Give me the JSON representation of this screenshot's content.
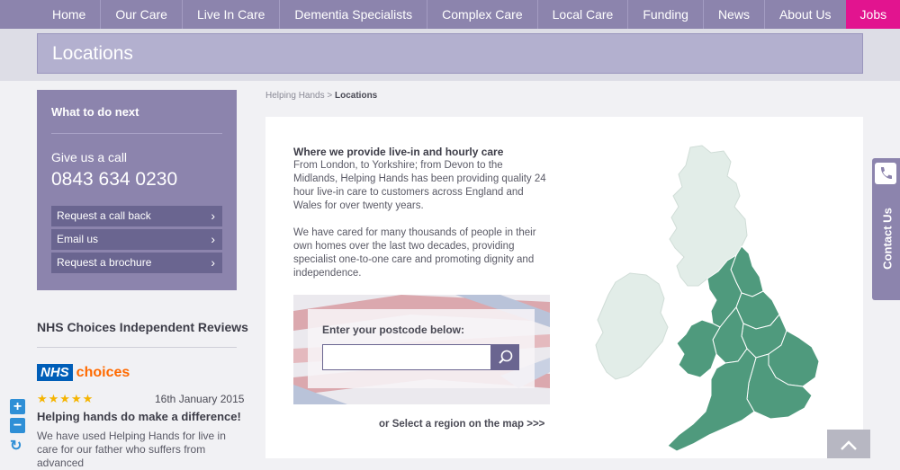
{
  "nav": {
    "items": [
      {
        "label": "Home"
      },
      {
        "label": "Our Care"
      },
      {
        "label": "Live In Care"
      },
      {
        "label": "Dementia Specialists"
      },
      {
        "label": "Complex Care"
      },
      {
        "label": "Local Care"
      },
      {
        "label": "Funding"
      },
      {
        "label": "News"
      },
      {
        "label": "About Us"
      },
      {
        "label": "Jobs"
      }
    ]
  },
  "page_title": "Locations",
  "breadcrumb": {
    "parent": "Helping Hands",
    "separator": " > ",
    "current": "Locations"
  },
  "what_next": {
    "title": "What to do next",
    "call_label": "Give us a call",
    "phone": "0843 634 0230",
    "buttons": [
      {
        "label": "Request a call back"
      },
      {
        "label": "Email us"
      },
      {
        "label": "Request a brochure"
      }
    ]
  },
  "reviews": {
    "heading": "NHS Choices Independent Reviews",
    "logo_nhs": "NHS",
    "logo_choices": "choices",
    "stars": "★★★★★",
    "date": "16th January 2015",
    "title": "Helping hands do make a difference!",
    "text": "We have used Helping Hands for live in care for our father who suffers from advanced"
  },
  "intro": {
    "heading": "Where we provide live-in and hourly care",
    "p1": "From London, to Yorkshire; from Devon to the Midlands, Helping Hands has been providing quality 24 hour live-in care to customers across England and Wales for over twenty years.",
    "p2": "We have cared for many thousands of people in their own homes over the last two decades, providing specialist one-to-one care and promoting dignity and independence."
  },
  "postcode": {
    "label": "Enter your postcode below:",
    "value": "",
    "placeholder": ""
  },
  "region_link": "or Select a region on the map >>>",
  "contact_tab": {
    "label": "Contact Us"
  },
  "colors": {
    "brand_purple": "#8c84ad",
    "jobs_pink": "#e2148f",
    "map_green": "#4f9a7d",
    "map_pale": "#e2ede8"
  },
  "icons": {
    "zoom_in": "+",
    "zoom_out": "−",
    "reset": "↻",
    "chevron": "›",
    "back_to_top": "chevron-up-icon"
  }
}
